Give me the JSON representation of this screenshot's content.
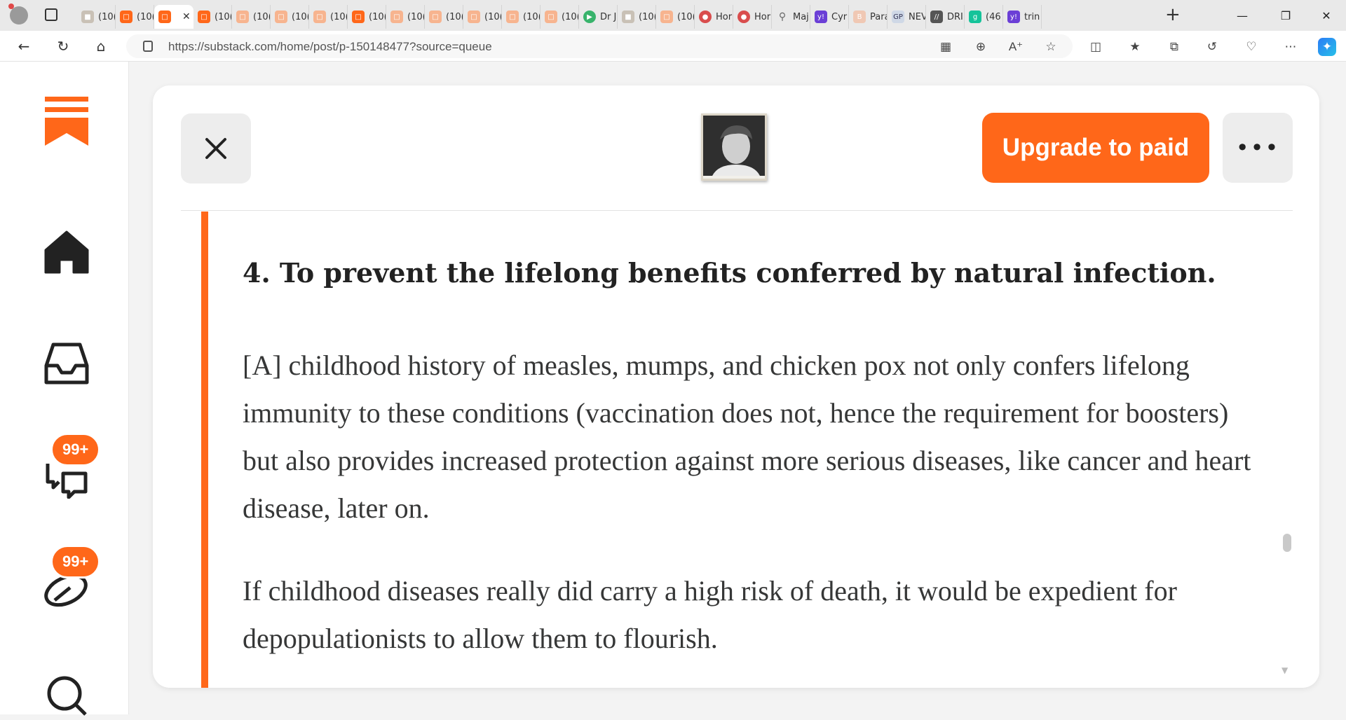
{
  "browser": {
    "tabs": [
      {
        "label": "(10(",
        "icon": "image-icon",
        "favclass": "gray",
        "active": false
      },
      {
        "label": "(10(",
        "icon": "substack-icon",
        "favclass": "ss",
        "active": false
      },
      {
        "label": "",
        "icon": "substack-icon",
        "favclass": "ss",
        "active": true
      },
      {
        "label": "(10(",
        "icon": "substack-icon",
        "favclass": "ss",
        "active": false
      },
      {
        "label": "(10(",
        "icon": "substack-icon",
        "favclass": "sspale",
        "active": false
      },
      {
        "label": "(10(",
        "icon": "substack-icon",
        "favclass": "sspale",
        "active": false
      },
      {
        "label": "(10(",
        "icon": "substack-icon",
        "favclass": "sspale",
        "active": false
      },
      {
        "label": "(10(",
        "icon": "substack-icon",
        "favclass": "ss",
        "active": false
      },
      {
        "label": "(10(",
        "icon": "substack-icon",
        "favclass": "sspale",
        "active": false
      },
      {
        "label": "(10(",
        "icon": "substack-icon",
        "favclass": "sspale",
        "active": false
      },
      {
        "label": "(10(",
        "icon": "substack-icon",
        "favclass": "sspale",
        "active": false
      },
      {
        "label": "(10(",
        "icon": "substack-icon",
        "favclass": "sspale",
        "active": false
      },
      {
        "label": "(10(",
        "icon": "substack-icon",
        "favclass": "sspale",
        "active": false
      },
      {
        "label": "Dr J",
        "icon": "play-icon",
        "favclass": "green",
        "active": false
      },
      {
        "label": "(10(",
        "icon": "image-icon",
        "favclass": "gray",
        "active": false
      },
      {
        "label": "(10(",
        "icon": "substack-icon",
        "favclass": "sspale",
        "active": false
      },
      {
        "label": "Hor",
        "icon": "profile-icon",
        "favclass": "red",
        "active": false
      },
      {
        "label": "Hor",
        "icon": "profile-icon",
        "favclass": "red",
        "active": false
      },
      {
        "label": "Maj",
        "icon": "search-icon",
        "favclass": "search",
        "active": false
      },
      {
        "label": "Cyr",
        "icon": "yahoo-icon",
        "favclass": "purple",
        "active": false
      },
      {
        "label": "Para",
        "icon": "b-icon",
        "favclass": "pale",
        "active": false
      },
      {
        "label": "NEV",
        "icon": "gp-icon",
        "favclass": "gp",
        "active": false
      },
      {
        "label": "DRI",
        "icon": "drudge-icon",
        "favclass": "dark",
        "active": false
      },
      {
        "label": "(46",
        "icon": "grammarly-icon",
        "favclass": "g",
        "active": false
      },
      {
        "label": "trin",
        "icon": "yahoo-icon",
        "favclass": "purple",
        "active": false
      }
    ],
    "new_tab": "+",
    "url": "https://substack.com/home/post/p-150148477?source=queue"
  },
  "sidebar": {
    "chat_badge": "99+",
    "activity_badge": "99+"
  },
  "post": {
    "upgrade_label": "Upgrade to paid",
    "heading": "4. To prevent the lifelong benefits conferred by natural infection.",
    "paragraph1": "[A] childhood history of measles, mumps, and chicken pox not only confers lifelong immunity to these conditions (vaccination does not, hence the requirement for boosters) but also provides increased protection against more serious diseases, like cancer and heart disease, later on.",
    "paragraph2": "If childhood diseases really did carry a high risk of death, it would be expedient for depopulationists to allow them to flourish."
  },
  "colors": {
    "accent": "#ff6719",
    "text": "#363737"
  }
}
